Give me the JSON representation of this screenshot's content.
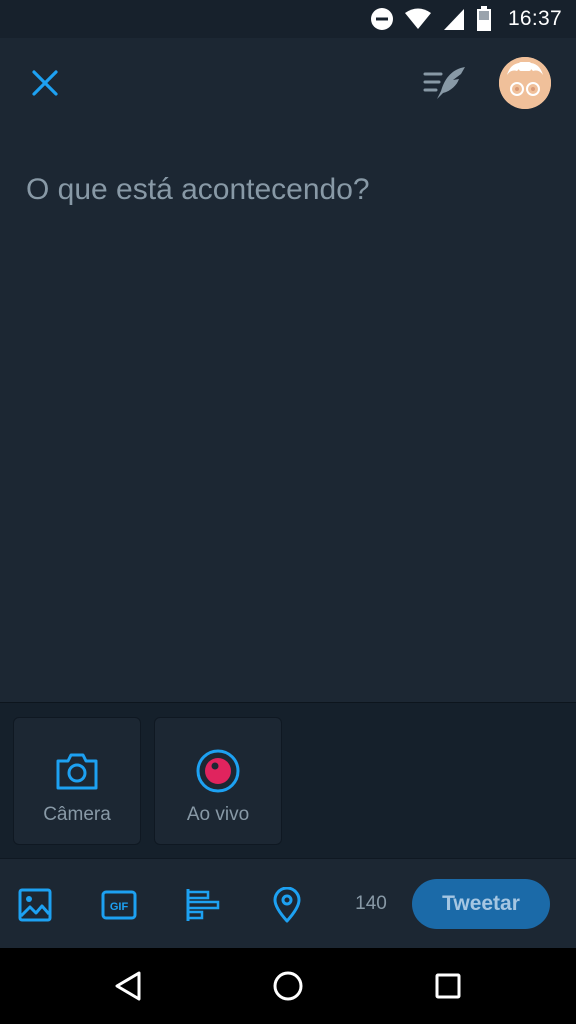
{
  "status_bar": {
    "time": "16:37",
    "icons": [
      "do-not-disturb-icon",
      "wifi-icon",
      "signal-icon",
      "battery-icon"
    ]
  },
  "header": {
    "close_icon": "close-icon",
    "drafts_icon": "drafts-icon",
    "avatar": "avatar"
  },
  "compose": {
    "placeholder": "O que está acontecendo?",
    "value": ""
  },
  "media_tray": {
    "items": [
      {
        "label": "Câmera",
        "icon": "camera-icon"
      },
      {
        "label": "Ao vivo",
        "icon": "live-icon"
      }
    ]
  },
  "toolbar": {
    "icons": [
      "image-icon",
      "gif-icon",
      "poll-icon",
      "location-icon"
    ],
    "char_count": "140",
    "tweet_label": "Tweetar"
  },
  "colors": {
    "background": "#1c2733",
    "accent": "#1da1f2",
    "placeholder": "#8899a6",
    "live": "#e0245e",
    "tweet_button": "#1b6aa8"
  },
  "nav_bar": {
    "icons": [
      "back-icon",
      "home-icon",
      "recents-icon"
    ]
  }
}
